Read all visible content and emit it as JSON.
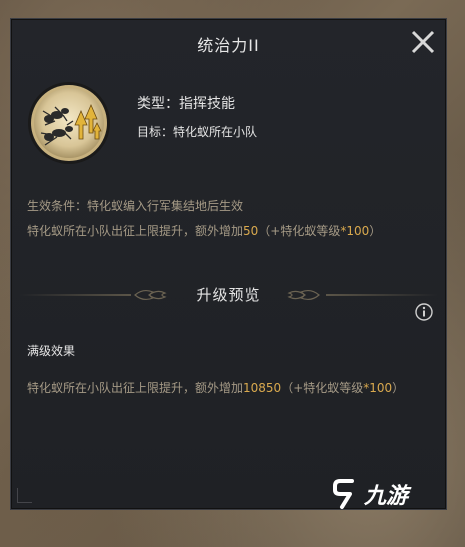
{
  "dialog": {
    "title": "统治力II",
    "skill": {
      "type": "类型：指挥技能",
      "target": "目标：特化蚁所在小队",
      "condition": "生效条件：特化蚁编入行军集结地后生效",
      "effect_prefix": "特化蚁所在小队出征上限提升，额外增加",
      "effect_value": "50",
      "effect_formula_open": "（+特化蚁等级",
      "effect_formula_mult": "*100",
      "effect_formula_close": "）"
    },
    "preview": {
      "title": "升级预览",
      "max_label": "满级效果",
      "effect_prefix": "特化蚁所在小队出征上限提升，额外增加",
      "effect_value": "10850",
      "effect_formula_open": "（+特化蚁等级",
      "effect_formula_mult": "*100",
      "effect_formula_close": "）"
    }
  },
  "icons": {
    "close": "close-icon",
    "info": "info-icon",
    "skill": "ant-command-skill-icon",
    "ornament": "leaf-ornament-icon"
  },
  "watermark": {
    "text": "九游"
  },
  "colors": {
    "highlight": "#d9a94e",
    "body_text": "#a59a86",
    "panel": "#222428"
  }
}
